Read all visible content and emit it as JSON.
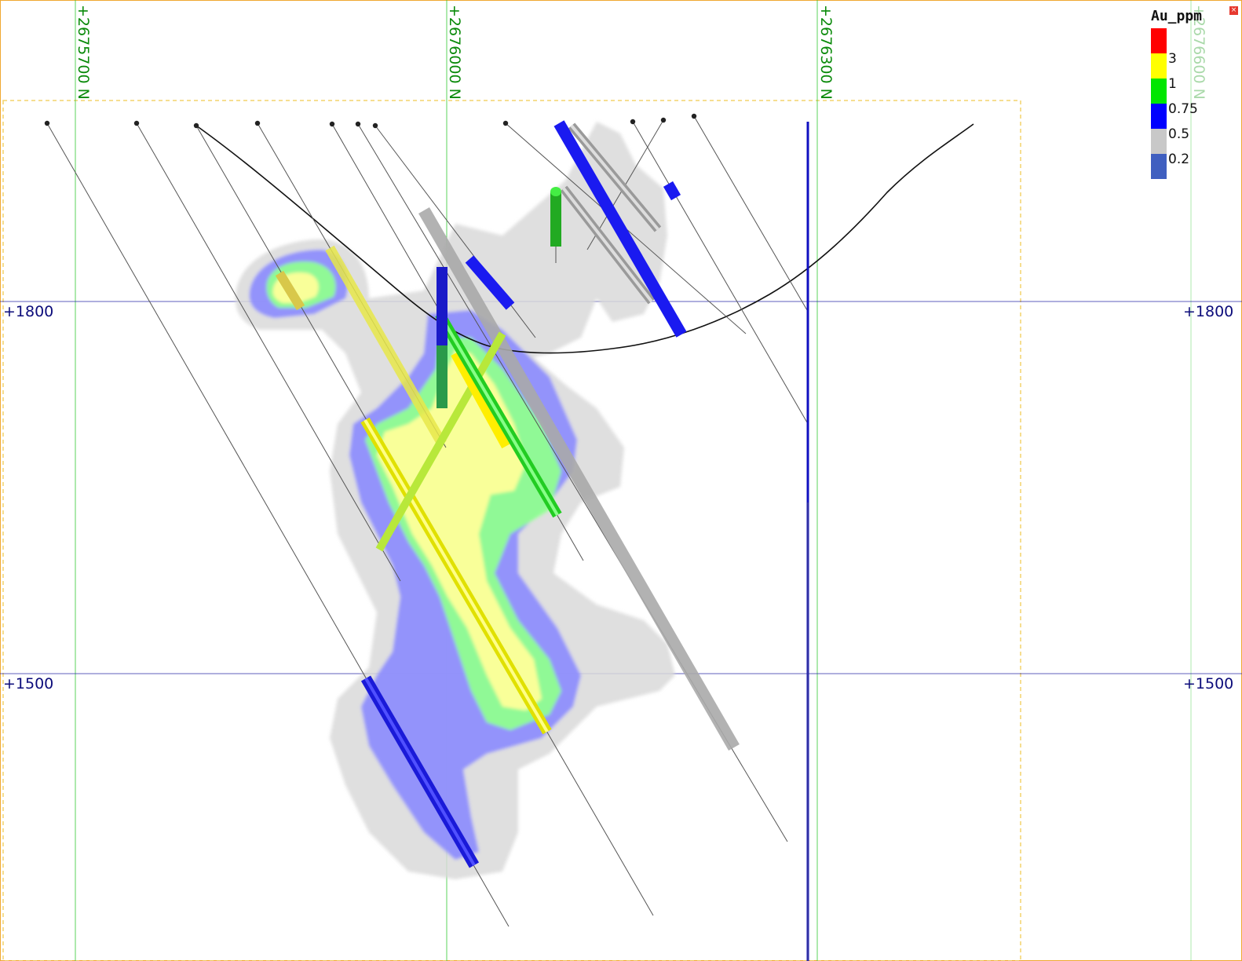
{
  "legend": {
    "title": "Au_ppm",
    "close_label": "×",
    "colors": [
      "#ff0000",
      "#ffff00",
      "#00e600",
      "#0000ff",
      "#c8c8c8",
      "#3f5fc0"
    ],
    "thresholds": [
      "3",
      "1",
      "0.75",
      "0.5",
      "0.2"
    ]
  },
  "northings": [
    "+2675700 N",
    "+2676000 N",
    "+2676300 N",
    "+2676600 N"
  ],
  "elevations": [
    "+1800",
    "+1500"
  ],
  "colors": {
    "northing_grid": "#32c832",
    "elevation_grid": "#1c1ca0",
    "section_frame": "#f3d36b",
    "topography": "#111111",
    "drillhole_trace": "#555555",
    "vertical_marker": "#1010c0"
  }
}
